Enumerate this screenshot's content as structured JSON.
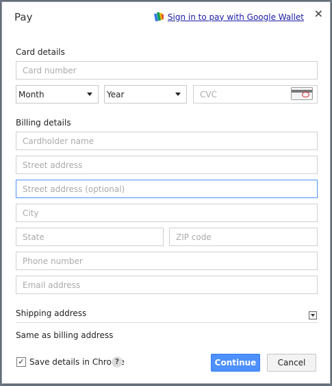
{
  "dialog": {
    "title": "Pay",
    "wallet_link": "Sign in to pay with Google Wallet",
    "close_label": "×"
  },
  "card": {
    "section_label": "Card details",
    "number_placeholder": "Card number",
    "month_value": "Month",
    "year_value": "Year",
    "cvc_placeholder": "CVC"
  },
  "billing": {
    "section_label": "Billing details",
    "cardholder_placeholder": "Cardholder name",
    "street_placeholder": "Street address",
    "street_optional_placeholder": "Street address (optional)",
    "city_placeholder": "City",
    "state_placeholder": "State",
    "zip_placeholder": "ZIP code",
    "phone_placeholder": "Phone number",
    "email_placeholder": "Email address"
  },
  "shipping": {
    "section_label": "Shipping address",
    "value": "Same as billing address"
  },
  "footer": {
    "save_label": "Save details in Chrome",
    "checkbox_mark": "✓",
    "help_label": "?",
    "continue_label": "Continue",
    "cancel_label": "Cancel"
  }
}
